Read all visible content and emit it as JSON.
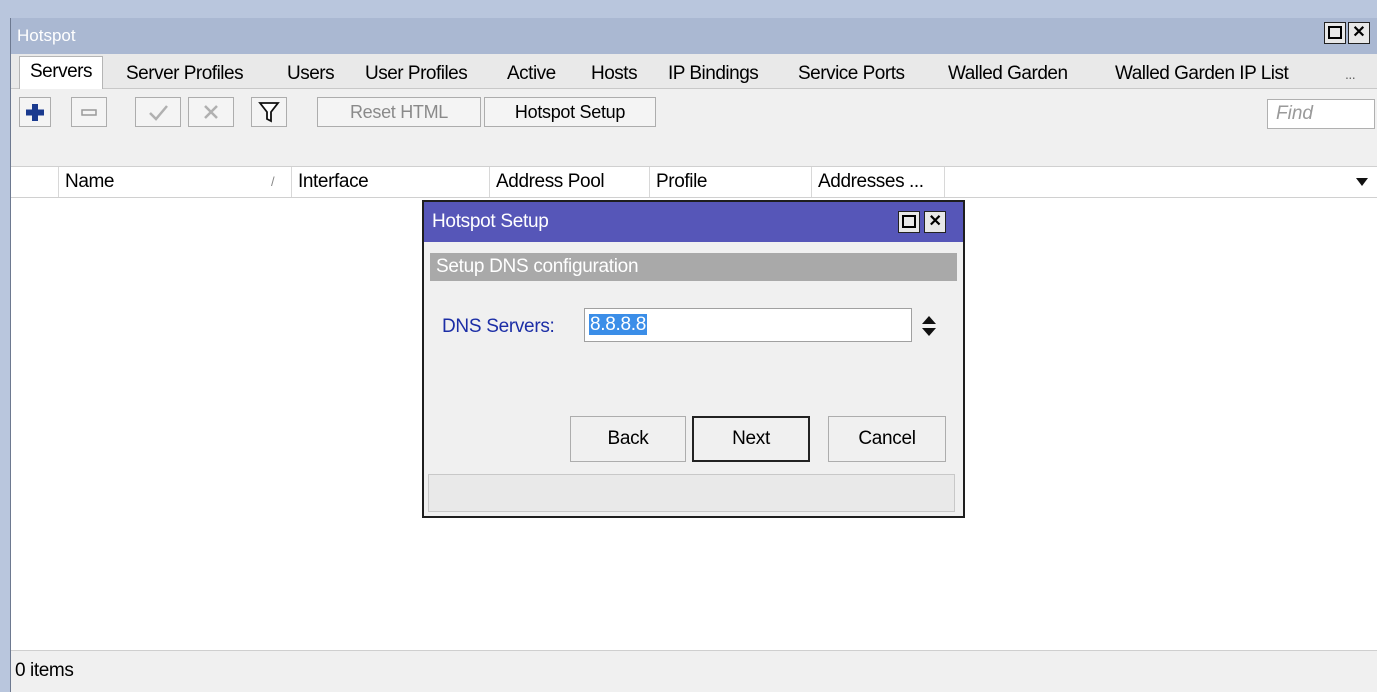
{
  "window": {
    "title": "Hotspot",
    "tabs": [
      {
        "label": "Servers"
      },
      {
        "label": "Server Profiles"
      },
      {
        "label": "Users"
      },
      {
        "label": "User Profiles"
      },
      {
        "label": "Active"
      },
      {
        "label": "Hosts"
      },
      {
        "label": "IP Bindings"
      },
      {
        "label": "Service Ports"
      },
      {
        "label": "Walled Garden"
      },
      {
        "label": "Walled Garden IP List"
      },
      {
        "label": "..."
      }
    ],
    "active_tab": "Servers"
  },
  "toolbar": {
    "reset_html_label": "Reset HTML",
    "hotspot_setup_label": "Hotspot Setup",
    "find_placeholder": "Find",
    "icons": [
      "plus-icon",
      "minus-icon",
      "check-icon",
      "cross-icon",
      "filter-icon"
    ]
  },
  "table": {
    "columns": [
      "Name",
      "Interface",
      "Address Pool",
      "Profile",
      "Addresses ..."
    ],
    "sort_indicator": "/",
    "rows": []
  },
  "status": {
    "items_text": "0 items"
  },
  "dialog": {
    "title": "Hotspot Setup",
    "step_title": "Setup DNS configuration",
    "dns_label": "DNS Servers:",
    "dns_value": "8.8.8.8",
    "buttons": {
      "back": "Back",
      "next": "Next",
      "cancel": "Cancel"
    }
  },
  "colors": {
    "dialog_title_bg": "#5656b8",
    "window_title_bg": "#aab8d2",
    "label_blue": "#1c2ea6",
    "selection_blue": "#3b8ee8",
    "plus_icon": "#1a3a8f"
  }
}
